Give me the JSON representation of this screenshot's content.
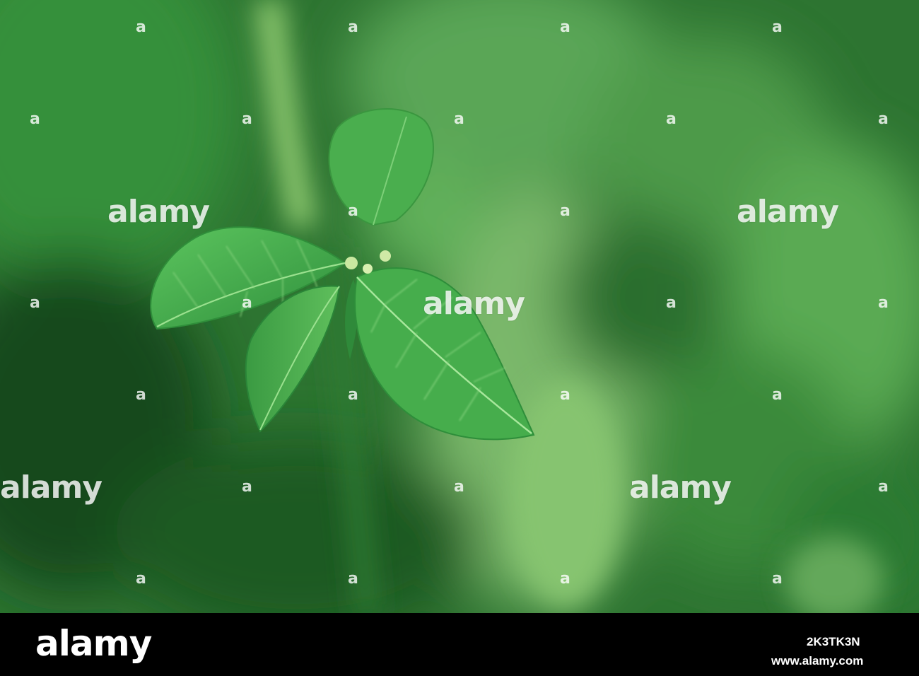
{
  "photo": {
    "subject": "green serrated leaves",
    "colors": {
      "background_dark": "#1f5a24",
      "background_mid": "#3f8f3c",
      "background_light": "#7cc46c",
      "leaf_main": "#3fa64a",
      "leaf_highlight": "#6fd070",
      "vein": "#a8e79c"
    }
  },
  "watermark": {
    "word": "alamy",
    "glyph": "a"
  },
  "footer": {
    "logo_text": "alamy",
    "image_id": "2K3TK3N",
    "url": "www.alamy.com"
  }
}
